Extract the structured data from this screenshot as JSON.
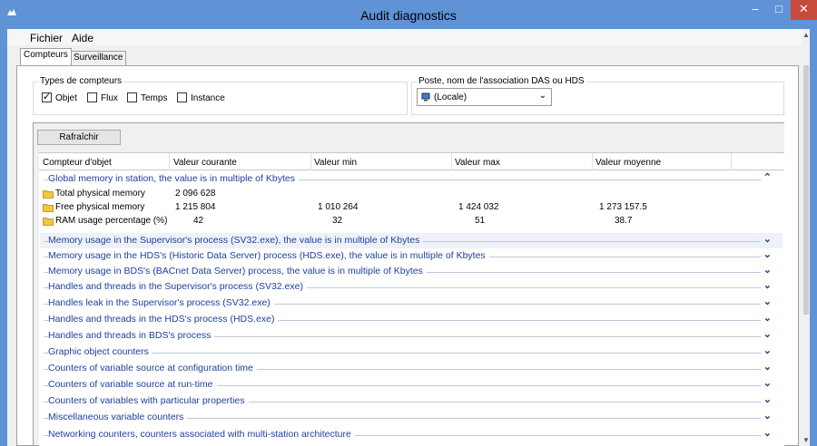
{
  "window": {
    "title": "Audit diagnostics"
  },
  "menu": {
    "file": "Fichier",
    "help": "Aide"
  },
  "tabs": [
    {
      "label": "Compteurs"
    },
    {
      "label": "Surveillance"
    }
  ],
  "counter_types": {
    "legend": "Types de compteurs",
    "options": [
      {
        "label": "Objet",
        "checked": true
      },
      {
        "label": "Flux",
        "checked": false
      },
      {
        "label": "Temps",
        "checked": false
      },
      {
        "label": "Instance",
        "checked": false
      }
    ]
  },
  "station": {
    "legend": "Poste, nom de l'association DAS ou HDS",
    "selected": "(Locale)"
  },
  "refresh_label": "Rafraîchir",
  "columns": [
    "Compteur d'objet",
    "Valeur courante",
    "Valeur min",
    "Valeur max",
    "Valeur moyenne"
  ],
  "groups": [
    {
      "title": "Global memory in station, the value is in multiple of Kbytes",
      "expanded": true,
      "rows": [
        {
          "name": "Total physical memory",
          "current": "2 096 628",
          "min": "",
          "max": "",
          "avg": ""
        },
        {
          "name": "Free physical memory",
          "current": "1 215 804",
          "min": "1 010 264",
          "max": "1 424 032",
          "avg": "1 273 157.5"
        },
        {
          "name": "RAM usage percentage (%)",
          "current": "42",
          "min": "32",
          "max": "51",
          "avg": "38.7"
        }
      ]
    },
    {
      "title": "Memory usage in the Supervisor's process (SV32.exe), the value is in multiple of Kbytes",
      "expanded": false
    },
    {
      "title": "Memory usage in the HDS's (Historic Data Server) process (HDS.exe), the value is in multiple of Kbytes",
      "expanded": false
    },
    {
      "title": "Memory usage in BDS's (BACnet Data Server) process, the value is in multiple of Kbytes",
      "expanded": false
    },
    {
      "title": "Handles and threads in the Supervisor's process (SV32.exe)",
      "expanded": false
    },
    {
      "title": "Handles leak in the Supervisor's process (SV32.exe)",
      "expanded": false
    },
    {
      "title": "Handles and threads in the HDS's process (HDS.exe)",
      "expanded": false
    },
    {
      "title": "Handles and threads in BDS's process",
      "expanded": false
    },
    {
      "title": "Graphic object counters",
      "expanded": false
    },
    {
      "title": "Counters of variable source at configuration time",
      "expanded": false
    },
    {
      "title": "Counters of variable source at run-time",
      "expanded": false
    },
    {
      "title": "Counters of variables with particular properties",
      "expanded": false
    },
    {
      "title": "Miscellaneous variable counters",
      "expanded": false
    },
    {
      "title": "Networking counters, counters associated with multi-station architecture",
      "expanded": false
    }
  ]
}
